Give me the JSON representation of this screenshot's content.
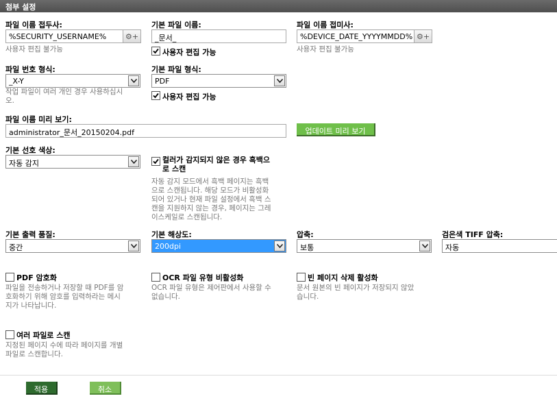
{
  "title": "첨부 설정",
  "prefix": {
    "label": "파일 이름 접두사:",
    "value": "%SECURITY_USERNAME%",
    "hint": "사용자 편집 불가능",
    "button_icon": "gear-plus-icon"
  },
  "basename": {
    "label": "기본 파일 이름:",
    "value": "_문서_",
    "checkbox_label": "사용자 편집 가능",
    "checked": true
  },
  "suffix": {
    "label": "파일 이름 접미사:",
    "value": "%DEVICE_DATE_YYYYMMDD%",
    "hint": "사용자 편집 불가능",
    "button_icon": "gear-plus-icon"
  },
  "numbering": {
    "label": "파일 번호 형식:",
    "value": "_X-Y",
    "hint_lines": [
      "작업 파일이 여러 개인 경우 사용하십시",
      "오."
    ]
  },
  "filetype": {
    "label": "기본 파일 형식:",
    "value": "PDF",
    "checkbox_label": "사용자 편집 가능",
    "checked": true
  },
  "preview": {
    "label": "파일 이름 미리 보기:",
    "value": "administrator_문서_20150204.pdf",
    "button_label": "업데이트 미리 보기"
  },
  "color": {
    "label": "기본 선호 색상:",
    "value": "자동 감지"
  },
  "bw_scan": {
    "checkbox_label_lines": [
      "컬러가 감지되지 않은 경우 흑백으",
      "로 스캔"
    ],
    "checked": true,
    "hint_lines": [
      "자동 감지 모드에서 흑백 페이지는 흑백",
      "으로 스캔됩니다. 해당 모드가 비활성화",
      "되어 있거나 현재 파일 설정에서 흑백 스",
      "캔을 지원하지 않는 경우, 페이지는 그레",
      "이스케일로 스캔됩니다."
    ]
  },
  "quality": {
    "label": "기본 출력 품질:",
    "value": "중간"
  },
  "resolution": {
    "label": "기본 해상도:",
    "value": "200dpi"
  },
  "compression": {
    "label": "압축:",
    "value": "보통"
  },
  "tiff": {
    "label": "검은색 TIFF 압축:",
    "value": "자동"
  },
  "pdf_encrypt": {
    "checkbox_label": "PDF 암호화",
    "checked": false,
    "hint_lines": [
      "파일을 전송하거나 저장할 때 PDF를 암",
      "호화하기 위해 암호를 입력하라는 메시",
      "지가 나타납니다."
    ]
  },
  "ocr": {
    "checkbox_label": "OCR 파일 유형 비활성화",
    "checked": false,
    "hint_lines": [
      "OCR 파일 유형은 제어판에서 사용할 수",
      "없습니다."
    ]
  },
  "blank_page": {
    "checkbox_label": "빈 페이지 삭제 활성화",
    "checked": false,
    "hint_lines": [
      "문서 원본의 빈 페이지가 저장되지 않았",
      "습니다."
    ]
  },
  "multi_file": {
    "checkbox_label": "여러 파일로 스캔",
    "checked": false,
    "hint_lines": [
      "지정된 페이지 수에 따라 페이지를 개별",
      "파일로 스캔합니다."
    ]
  },
  "actions": {
    "apply": "적용",
    "cancel": "취소"
  },
  "colors": {
    "titlebar": "#555555",
    "apply_green": "#2e6b2e",
    "cancel_green": "#7fbf5a",
    "preview_green": "#6fbf4a",
    "selection_blue": "#3399ff"
  }
}
